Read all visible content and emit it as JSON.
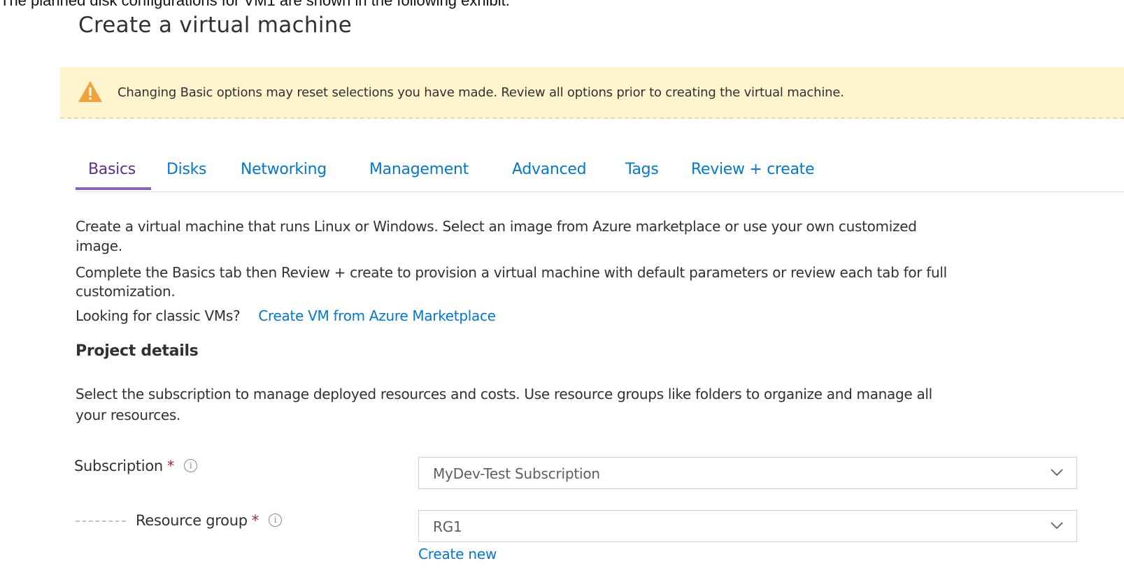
{
  "intro_line": "The planned disk configurations for VM1 are shown in the following exhibit.",
  "page_title": "Create a virtual machine",
  "warning": {
    "text": "Changing Basic options may reset selections you have made. Review all options prior to creating the virtual machine.",
    "icon": "warning-triangle-icon",
    "color": "#fff4ce"
  },
  "tabs": [
    {
      "label": "Basics",
      "active": true
    },
    {
      "label": "Disks",
      "active": false
    },
    {
      "label": "Networking",
      "active": false
    },
    {
      "label": "Management",
      "active": false
    },
    {
      "label": "Advanced",
      "active": false
    },
    {
      "label": "Tags",
      "active": false
    },
    {
      "label": "Review + create",
      "active": false
    }
  ],
  "description": {
    "line1": "Create a virtual machine that runs Linux or Windows. Select an image from Azure marketplace or use your own customized",
    "line2": "image.",
    "line3": "Complete the Basics tab then Review + create to provision a virtual machine with default parameters or review each tab for full",
    "line4": "customization.",
    "classic_prompt": "Looking for classic VMs?",
    "classic_link": "Create VM from Azure Marketplace"
  },
  "project_details": {
    "title": "Project details",
    "line1": "Select the subscription to manage deployed resources and costs. Use resource groups like folders to organize and manage all",
    "line2": "your resources."
  },
  "fields": {
    "subscription": {
      "label": "Subscription",
      "required_mark": "*",
      "value": "MyDev-Test Subscription"
    },
    "resource_group": {
      "label": "Resource group",
      "required_mark": "*",
      "value": "RG1",
      "create_new": "Create new"
    }
  },
  "colors": {
    "link": "#0078d4",
    "active_tab": "#5c2d91",
    "tab_underline": "#8764b8"
  }
}
